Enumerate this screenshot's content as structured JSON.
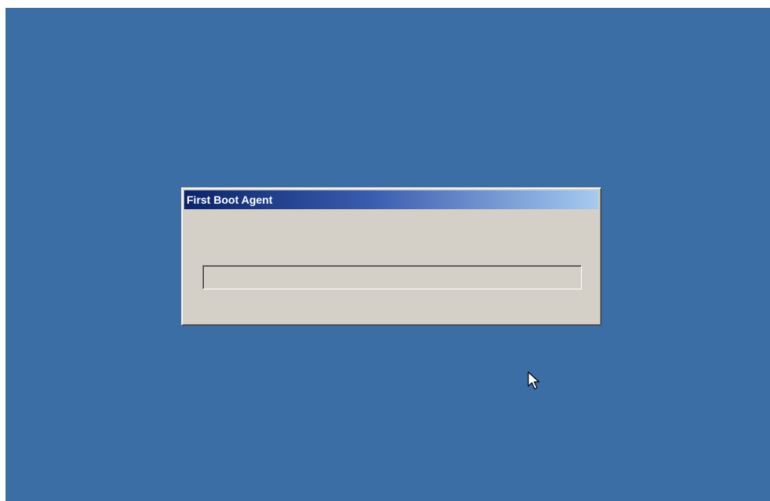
{
  "window": {
    "title": "First Boot Agent"
  },
  "progress": {
    "value": 0
  },
  "colors": {
    "desktop": "#3a6ea5",
    "dialog_face": "#d4d0c8",
    "titlebar_start": "#0a246a",
    "titlebar_end": "#a6caf0"
  },
  "icons": {
    "cursor": "arrow-cursor-icon"
  }
}
